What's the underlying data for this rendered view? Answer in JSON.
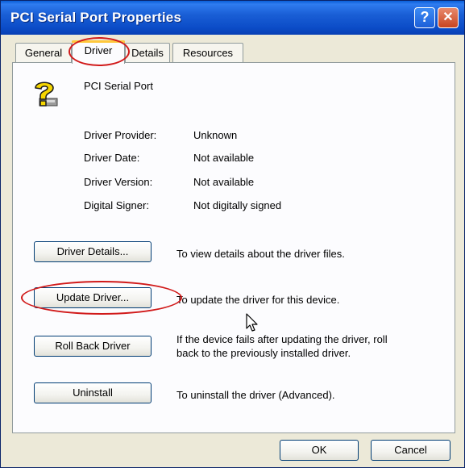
{
  "window": {
    "title": "PCI Serial Port Properties"
  },
  "tabs": [
    {
      "label": "General"
    },
    {
      "label": "Driver"
    },
    {
      "label": "Details"
    },
    {
      "label": "Resources"
    }
  ],
  "device": {
    "name": "PCI Serial Port",
    "icon": "question-mark-device-icon"
  },
  "info": [
    {
      "label": "Driver Provider:",
      "value": "Unknown"
    },
    {
      "label": "Driver Date:",
      "value": "Not available"
    },
    {
      "label": "Driver Version:",
      "value": "Not available"
    },
    {
      "label": "Digital Signer:",
      "value": "Not digitally signed"
    }
  ],
  "actions": {
    "details": {
      "label": "Driver Details...",
      "description": "To view details about the driver files."
    },
    "update": {
      "label": "Update Driver...",
      "description": "To update the driver for this device."
    },
    "rollback": {
      "label": "Roll Back Driver",
      "description_line1": "If the device fails after updating the driver, roll",
      "description_line2": "back to the previously installed driver."
    },
    "uninstall": {
      "label": "Uninstall",
      "description": "To uninstall the driver (Advanced)."
    }
  },
  "footer": {
    "ok_label": "OK",
    "cancel_label": "Cancel"
  },
  "colors": {
    "titlebar": "#0b4cc7",
    "highlight_ellipse": "#d11a1a",
    "tab_accent": "#ffc83c"
  }
}
